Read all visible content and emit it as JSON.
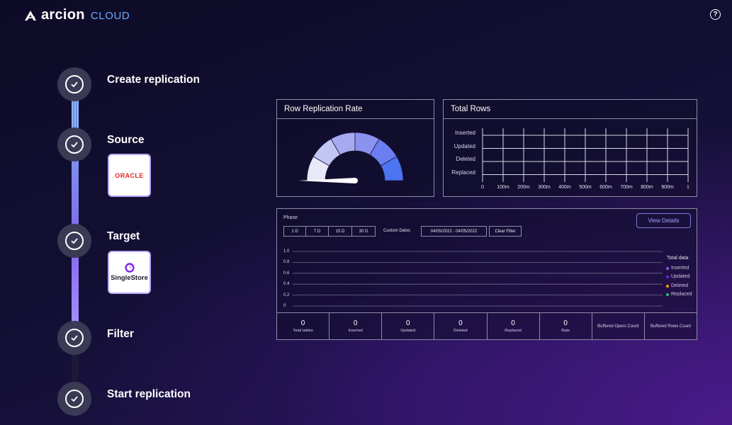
{
  "app": {
    "logo_word": "arcion",
    "logo_cloud": "CLOUD",
    "help_glyph": "?"
  },
  "colors": {
    "background": "#120f33",
    "accent": "#6ea8ff",
    "step_circle": "#3b3a55",
    "rail_blue": "#8fb6ff",
    "rail_purple": "#a58cff",
    "oracle_red": "#e0271d"
  },
  "stepper": {
    "steps": [
      {
        "label": "Create replication"
      },
      {
        "label": "Source",
        "card_text": "ORACLE"
      },
      {
        "label": "Target",
        "card_text": "SingleStore"
      },
      {
        "label": "Filter"
      },
      {
        "label": "Start replication"
      }
    ]
  },
  "gauge": {
    "title": "Row Replication Rate",
    "value_fraction": 0.0,
    "segment_colors": [
      "#e8e9f8",
      "#c2c6f2",
      "#a8aaf1",
      "#8c93ef",
      "#6a7ef0",
      "#4d74f1"
    ]
  },
  "total_rows": {
    "title": "Total Rows",
    "row_labels": [
      "Inserted",
      "Updated",
      "Deleted",
      "Replaced"
    ],
    "x_ticks": [
      "0",
      "100m",
      "200m",
      "300m",
      "400m",
      "500m",
      "600m",
      "700m",
      "800m",
      "900m",
      "1"
    ]
  },
  "phase": {
    "label": "Phase",
    "ranges": [
      "1 D",
      "7 D",
      "15 D",
      "30 D"
    ],
    "custom_dates_label": "Custom Dates",
    "date_range": "04/05/2022 - 04/05/2022",
    "clear_filter": "Clear Filter",
    "view_details": "View Details",
    "y_ticks": [
      "1.0",
      "0.8",
      "0.6",
      "0.4",
      "0.2",
      "0"
    ],
    "legend_title": "Total data",
    "legend": [
      {
        "name": "Inserted",
        "color": "#8b5cf6"
      },
      {
        "name": "Updated",
        "color": "#6d28d9"
      },
      {
        "name": "Deleted",
        "color": "#f59e0b"
      },
      {
        "name": "Replaced",
        "color": "#22c55e"
      }
    ]
  },
  "stats": [
    {
      "value": "0",
      "label": "Total tables"
    },
    {
      "value": "0",
      "label": "Inserted"
    },
    {
      "value": "0",
      "label": "Updated"
    },
    {
      "value": "0",
      "label": "Deleted"
    },
    {
      "value": "0",
      "label": "Replaced"
    },
    {
      "value": "0",
      "label": "Rate"
    },
    {
      "label": "Buffered Opers Count"
    },
    {
      "label": "Buffered Rows Count"
    }
  ]
}
